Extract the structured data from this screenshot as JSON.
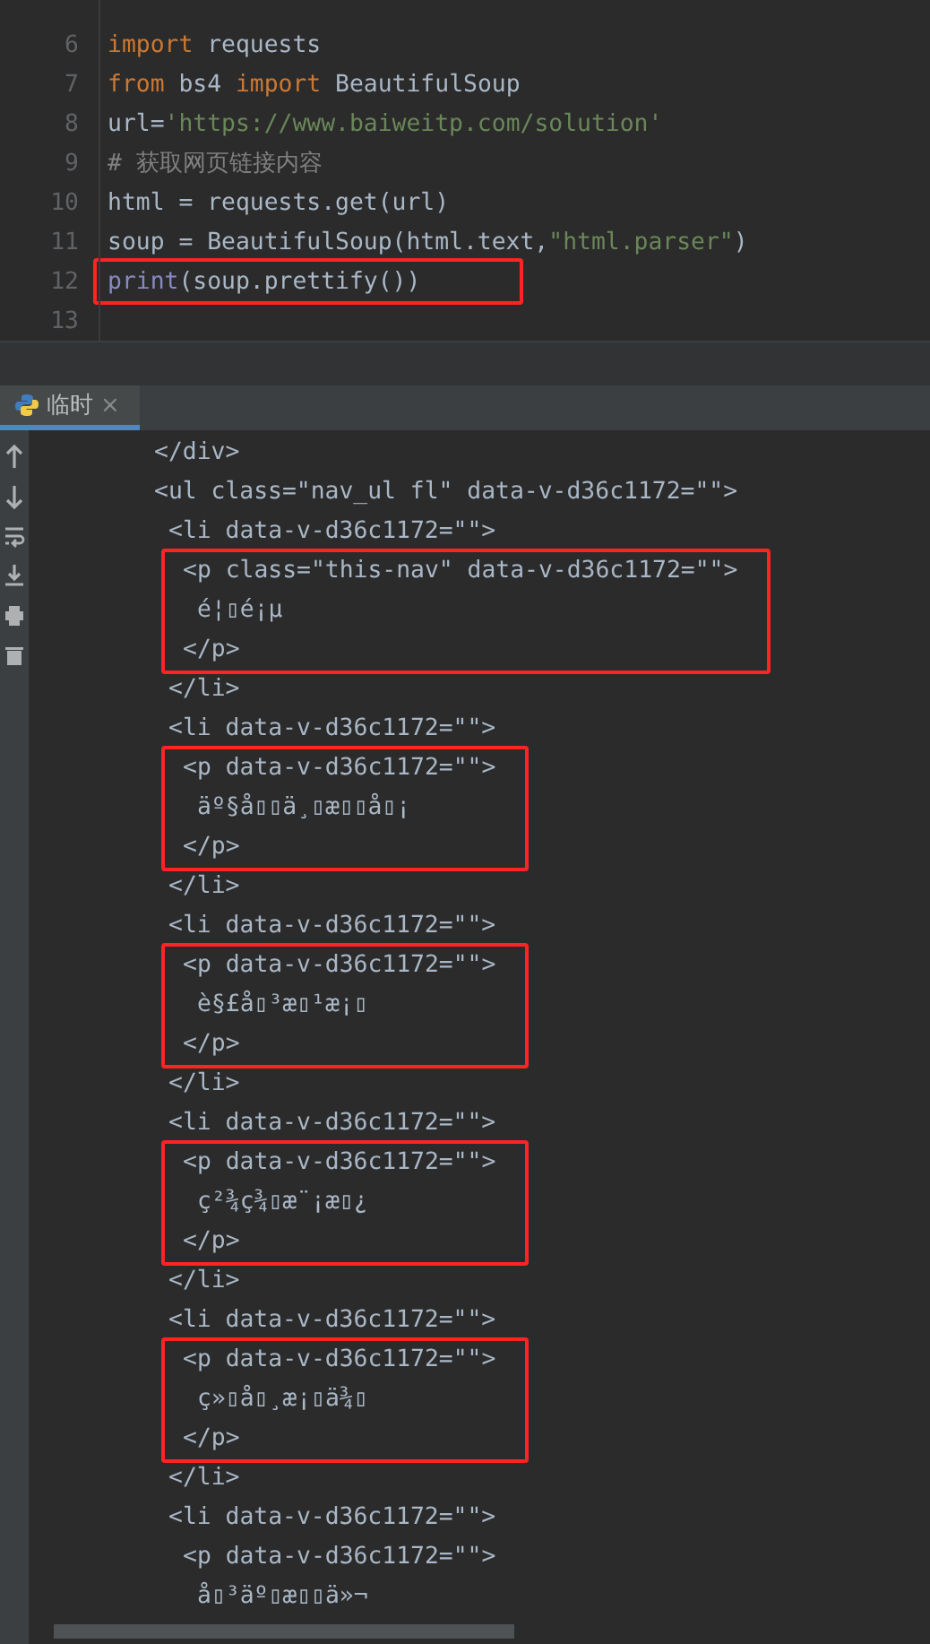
{
  "editor": {
    "lines": [
      {
        "number": "6",
        "tokens": [
          {
            "t": "import",
            "kind": "keyword"
          },
          {
            "t": " requests",
            "kind": "plain"
          }
        ]
      },
      {
        "number": "7",
        "tokens": [
          {
            "t": "from",
            "kind": "keyword"
          },
          {
            "t": " bs4 ",
            "kind": "plain"
          },
          {
            "t": "import",
            "kind": "keyword"
          },
          {
            "t": " BeautifulSoup",
            "kind": "plain"
          }
        ]
      },
      {
        "number": "8",
        "tokens": [
          {
            "t": "url=",
            "kind": "plain"
          },
          {
            "t": "'https://www.baiweitp.com/solution'",
            "kind": "string"
          }
        ]
      },
      {
        "number": "9",
        "tokens": [
          {
            "t": "# 获取网页链接内容",
            "kind": "comment"
          }
        ]
      },
      {
        "number": "10",
        "tokens": [
          {
            "t": "html = requests.get(url)",
            "kind": "plain"
          }
        ]
      },
      {
        "number": "11",
        "tokens": [
          {
            "t": "soup = BeautifulSoup(html.text,",
            "kind": "plain"
          },
          {
            "t": "\"html.parser\"",
            "kind": "string"
          },
          {
            "t": ")",
            "kind": "plain"
          }
        ]
      },
      {
        "number": "12",
        "highlighted": true,
        "tokens": [
          {
            "t": "print",
            "kind": "builtin"
          },
          {
            "t": "(soup.prettify())",
            "kind": "plain"
          }
        ]
      },
      {
        "number": "13"
      }
    ]
  },
  "run_tab": {
    "label": "临时",
    "close": "×",
    "selected": true
  },
  "output": [
    {
      "text": "</div>"
    },
    {
      "open": "<ul class=\"nav_ul fl\" data-v-d36c1172=\"\">",
      "children": [
        {
          "open": "<li data-v-d36c1172=\"\">",
          "close": "</li>",
          "children": [
            {
              "open": "<p class=\"this-nav\" data-v-d36c1172=\"\">",
              "close": "</p>",
              "highlighted": true,
              "children": [
                {
                  "text": "é¦▯é¡µ"
                }
              ]
            }
          ]
        },
        {
          "open": "<li data-v-d36c1172=\"\">",
          "close": "</li>",
          "children": [
            {
              "open": "<p data-v-d36c1172=\"\">",
              "close": "</p>",
              "highlighted": true,
              "children": [
                {
                  "text": "äº§å▯▯ä¸▯æ▯▯å▯¡"
                }
              ]
            }
          ]
        },
        {
          "open": "<li data-v-d36c1172=\"\">",
          "close": "</li>",
          "children": [
            {
              "open": "<p data-v-d36c1172=\"\">",
              "close": "</p>",
              "highlighted": true,
              "children": [
                {
                  "text": "è§£å▯³æ▯¹æ¡▯"
                }
              ]
            }
          ]
        },
        {
          "open": "<li data-v-d36c1172=\"\">",
          "close": "</li>",
          "children": [
            {
              "open": "<p data-v-d36c1172=\"\">",
              "close": "</p>",
              "highlighted": true,
              "children": [
                {
                  "text": "ç²¾ç¾▯æ¨¡æ▯¿"
                }
              ]
            }
          ]
        },
        {
          "open": "<li data-v-d36c1172=\"\">",
          "close": "</li>",
          "children": [
            {
              "open": "<p data-v-d36c1172=\"\">",
              "close": "</p>",
              "highlighted": true,
              "children": [
                {
                  "text": "ç»▯å▯¸æ¡▯ä¾▯"
                }
              ]
            }
          ]
        },
        {
          "open": "<li data-v-d36c1172=\"\">",
          "children": [
            {
              "open": "<p data-v-d36c1172=\"\">",
              "children": [
                {
                  "text": "å▯³äº▯æ▯▯ä»¬"
                }
              ]
            }
          ]
        }
      ]
    }
  ]
}
